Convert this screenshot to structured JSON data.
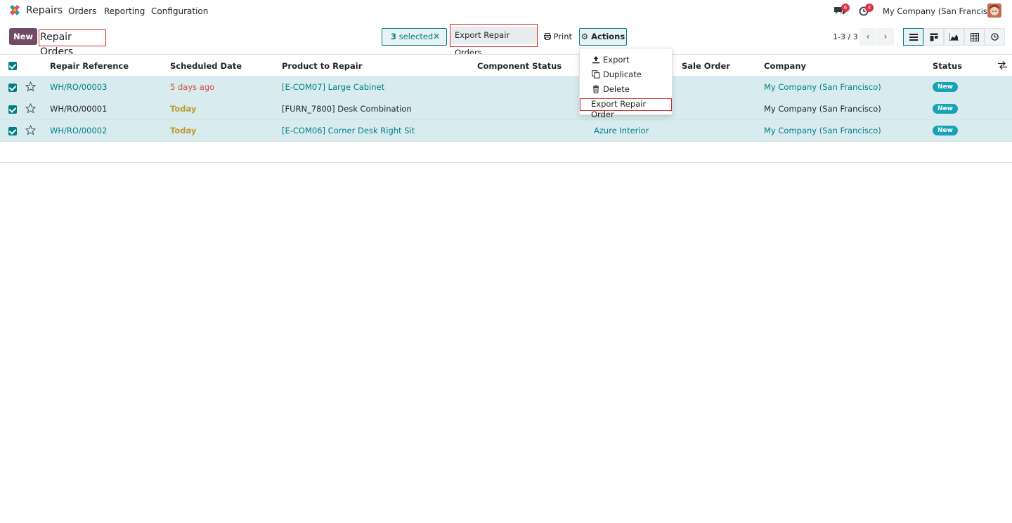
{
  "navbar": {
    "app_name": "Repairs",
    "menu": [
      "Orders",
      "Reporting",
      "Configuration"
    ],
    "messages_count": "6",
    "activities_count": "4",
    "company": "My Company (San Francisco)"
  },
  "control_panel": {
    "new_label": "New",
    "breadcrumb": "Repair Orders",
    "selected_count": "3",
    "selected_text": "selected",
    "export_label": "Export Repair Orders",
    "print_label": "Print",
    "actions_label": "Actions",
    "pager": "1-3 / 3"
  },
  "actions_menu": {
    "items": [
      "Export",
      "Duplicate",
      "Delete",
      "Export Repair Order"
    ]
  },
  "table": {
    "columns": [
      "Repair Reference",
      "Scheduled Date",
      "Product to Repair",
      "Component Status",
      "Sale Order",
      "Company",
      "Status"
    ],
    "rows": [
      {
        "ref": "WH/RO/00003",
        "date": "5 days ago",
        "product": "[E-COM07] Large Cabinet",
        "customer": "",
        "sale_order": "",
        "company": "My Company (San Francisco)",
        "status": "New"
      },
      {
        "ref": "WH/RO/00001",
        "date": "Today",
        "product": "[FURN_7800] Desk Combination",
        "customer": "",
        "sale_order": "",
        "company": "My Company (San Francisco)",
        "status": "New"
      },
      {
        "ref": "WH/RO/00002",
        "date": "Today",
        "product": "[E-COM06] Corner Desk Right Sit",
        "customer": "Azure Interior",
        "sale_order": "",
        "company": "My Company (San Francisco)",
        "status": "New"
      }
    ]
  },
  "colors": {
    "brand": "#714B67",
    "accent": "#017e84",
    "overdue": "#d44c3b",
    "today": "#c19a2e",
    "status_new": "#17a2b8",
    "highlight_border": "#d72a2a"
  }
}
